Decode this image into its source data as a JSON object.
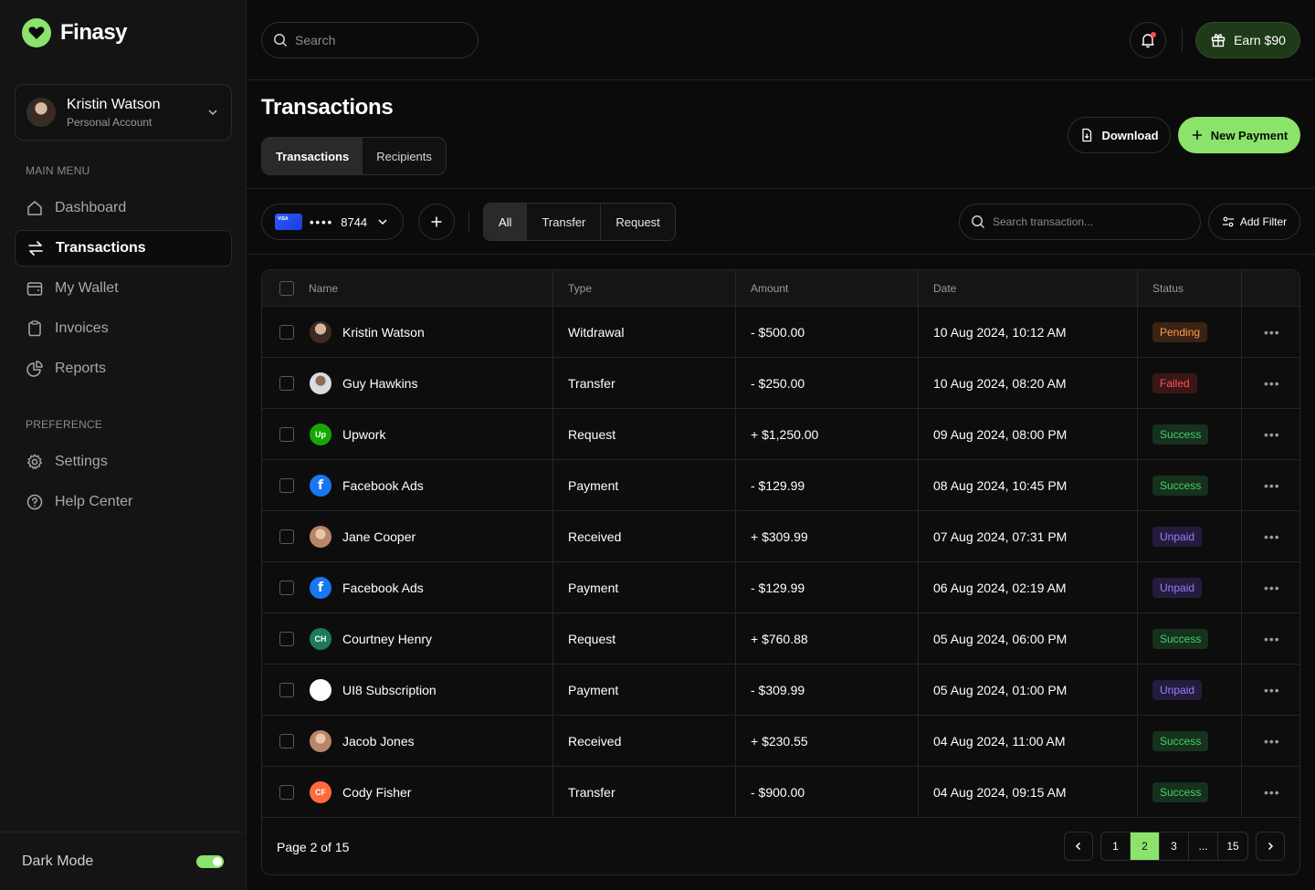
{
  "app": {
    "name": "Finasy"
  },
  "account": {
    "name": "Kristin Watson",
    "type": "Personal Account"
  },
  "sidebar": {
    "main_menu_title": "MAIN MENU",
    "main_items": [
      {
        "label": "Dashboard",
        "icon": "home-icon"
      },
      {
        "label": "Transactions",
        "icon": "transfer-icon"
      },
      {
        "label": "My Wallet",
        "icon": "wallet-icon"
      },
      {
        "label": "Invoices",
        "icon": "clipboard-icon"
      },
      {
        "label": "Reports",
        "icon": "pie-chart-icon"
      }
    ],
    "preference_title": "PREFERENCE",
    "pref_items": [
      {
        "label": "Settings",
        "icon": "gear-icon"
      },
      {
        "label": "Help Center",
        "icon": "help-icon"
      }
    ],
    "dark_mode_label": "Dark Mode",
    "dark_mode_on": true
  },
  "topbar": {
    "search_placeholder": "Search",
    "earn_label": "Earn $90"
  },
  "header": {
    "title": "Transactions",
    "tabs": [
      "Transactions",
      "Recipients"
    ],
    "download_label": "Download",
    "new_payment_label": "New Payment"
  },
  "filters": {
    "card_mask": "••••",
    "card_last4": "8744",
    "type_tabs": [
      "All",
      "Transfer",
      "Request"
    ],
    "search_placeholder": "Search transaction...",
    "add_filter_label": "Add Filter"
  },
  "table": {
    "columns": [
      "Name",
      "Type",
      "Amount",
      "Date",
      "Status"
    ],
    "rows": [
      {
        "name": "Kristin Watson",
        "avatar": "",
        "type": "Witdrawal",
        "amount": "- $500.00",
        "date": "10 Aug 2024, 10:12 AM",
        "status": "Pending"
      },
      {
        "name": "Guy Hawkins",
        "avatar": "",
        "type": "Transfer",
        "amount": "- $250.00",
        "date": "10 Aug 2024, 08:20 AM",
        "status": "Failed"
      },
      {
        "name": "Upwork",
        "avatar": "Up",
        "type": "Request",
        "amount": "+ $1,250.00",
        "date": "09 Aug 2024, 08:00 PM",
        "status": "Success"
      },
      {
        "name": "Facebook Ads",
        "avatar": "f",
        "type": "Payment",
        "amount": "- $129.99",
        "date": "08 Aug 2024, 10:45 PM",
        "status": "Success"
      },
      {
        "name": "Jane Cooper",
        "avatar": "",
        "type": "Received",
        "amount": "+ $309.99",
        "date": "07 Aug 2024, 07:31 PM",
        "status": "Unpaid"
      },
      {
        "name": "Facebook Ads",
        "avatar": "f",
        "type": "Payment",
        "amount": "- $129.99",
        "date": "06 Aug 2024, 02:19 AM",
        "status": "Unpaid"
      },
      {
        "name": "Courtney Henry",
        "avatar": "CH",
        "type": "Request",
        "amount": "+ $760.88",
        "date": "05 Aug 2024, 06:00 PM",
        "status": "Success"
      },
      {
        "name": "UI8 Subscription",
        "avatar": "",
        "type": "Payment",
        "amount": "- $309.99",
        "date": "05 Aug 2024, 01:00 PM",
        "status": "Unpaid"
      },
      {
        "name": "Jacob Jones",
        "avatar": "",
        "type": "Received",
        "amount": "+ $230.55",
        "date": "04 Aug 2024, 11:00 AM",
        "status": "Success"
      },
      {
        "name": "Cody Fisher",
        "avatar": "CF",
        "type": "Transfer",
        "amount": "- $900.00",
        "date": "04 Aug 2024, 09:15 AM",
        "status": "Success"
      }
    ]
  },
  "pagination": {
    "info": "Page 2 of 15",
    "pages": [
      "1",
      "2",
      "3",
      "...",
      "15"
    ],
    "current": "2",
    "prev_icon": "chevron-left-icon",
    "next_icon": "chevron-right-icon"
  },
  "colors": {
    "accent": "#8be36b",
    "background": "#0b0b0b",
    "sidebar": "#141414",
    "pending": "#ff9a4a",
    "failed": "#ff5555",
    "success": "#45d068",
    "unpaid": "#9b7cff"
  }
}
